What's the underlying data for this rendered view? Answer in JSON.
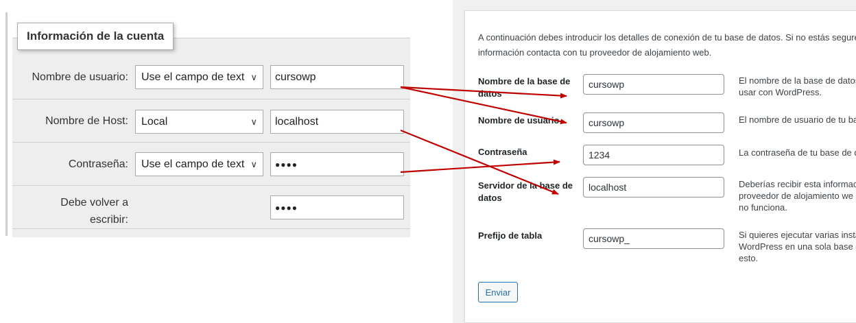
{
  "left": {
    "legend": "Información de la cuenta",
    "rows": [
      {
        "label": "Nombre de usuario:",
        "select": "Use el campo de text",
        "value": "cursowp"
      },
      {
        "label": "Nombre de Host:",
        "select": "Local",
        "value": "localhost"
      },
      {
        "label": "Contraseña:",
        "select": "Use el campo de text",
        "value": "●●●●"
      },
      {
        "label_line1": "Debe volver a",
        "label_line2": "escribir:",
        "value": "●●●●"
      }
    ]
  },
  "right": {
    "intro_line1": "A continuación debes introducir los detalles de conexión de tu base de datos. Si no estás segure",
    "intro_line2": "información contacta con tu proveedor de alojamiento web.",
    "fields": [
      {
        "label_line1": "Nombre de la base de",
        "label_line2": "datos",
        "value": "cursowp",
        "desc_line1": "El nombre de la base de datos",
        "desc_line2": "usar con WordPress."
      },
      {
        "label_line1": "Nombre de usuario",
        "value": "cursowp",
        "desc_line1": "El nombre de usuario de tu ba"
      },
      {
        "label_line1": "Contraseña",
        "value": "1234",
        "desc_line1": "La contraseña de tu base de d"
      },
      {
        "label_line1": "Servidor de la base de",
        "label_line2": "datos",
        "value": "localhost",
        "desc_line1": "Deberías recibir esta informac",
        "desc_line2": "proveedor de alojamiento we",
        "desc_line3": "no funciona."
      },
      {
        "label_line1": "Prefijo de tabla",
        "value": "cursowp_",
        "desc_line1": "Si quieres ejecutar varias insta",
        "desc_line2": "WordPress en una sola base d",
        "desc_line3": "esto."
      }
    ],
    "submit_label": "Enviar"
  },
  "colors": {
    "arrow": "#c00000",
    "wp_blue": "#2271b1"
  }
}
